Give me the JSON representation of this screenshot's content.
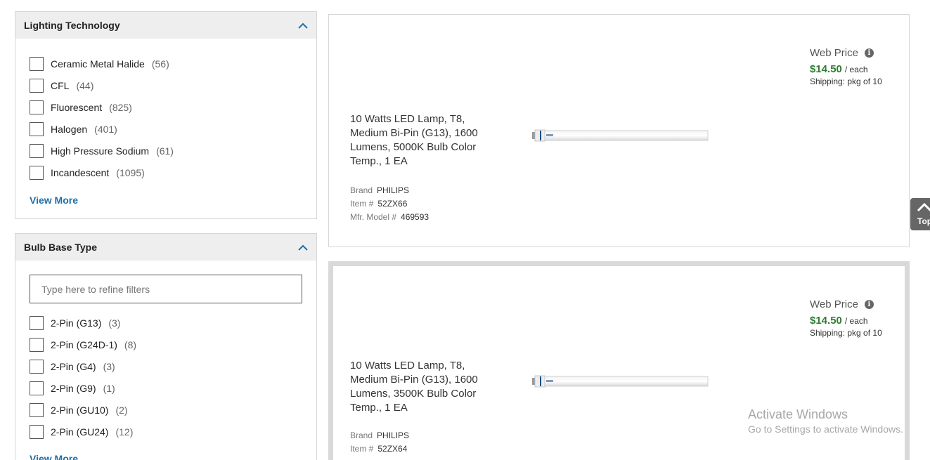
{
  "filters": [
    {
      "title": "Lighting Technology",
      "options": [
        {
          "label": "Ceramic Metal Halide",
          "count": "(56)"
        },
        {
          "label": "CFL",
          "count": "(44)"
        },
        {
          "label": "Fluorescent",
          "count": "(825)"
        },
        {
          "label": "Halogen",
          "count": "(401)"
        },
        {
          "label": "High Pressure Sodium",
          "count": "(61)"
        },
        {
          "label": "Incandescent",
          "count": "(1095)"
        }
      ],
      "view_more": "View More"
    },
    {
      "title": "Bulb Base Type",
      "search_placeholder": "Type here to refine filters",
      "options": [
        {
          "label": "2-Pin (G13)",
          "count": "(3)"
        },
        {
          "label": "2-Pin (G24D-1)",
          "count": "(8)"
        },
        {
          "label": "2-Pin (G4)",
          "count": "(3)"
        },
        {
          "label": "2-Pin (G9)",
          "count": "(1)"
        },
        {
          "label": "2-Pin (GU10)",
          "count": "(2)"
        },
        {
          "label": "2-Pin (GU24)",
          "count": "(12)"
        }
      ],
      "view_more": "View More"
    }
  ],
  "products": [
    {
      "title": "10 Watts LED Lamp, T8, Medium Bi-Pin (G13), 1600 Lumens, 5000K Bulb Color Temp., 1 EA",
      "brand_label": "Brand",
      "brand": "PHILIPS",
      "item_label": "Item #",
      "item": "52ZX66",
      "model_label": "Mfr. Model #",
      "model": "469593",
      "web_price_label": "Web Price",
      "price": "$14.50",
      "unit": "/ each",
      "shipping": "Shipping: pkg of 10"
    },
    {
      "title": "10 Watts LED Lamp, T8, Medium Bi-Pin (G13), 1600 Lumens, 3500K Bulb Color Temp., 1 EA",
      "brand_label": "Brand",
      "brand": "PHILIPS",
      "item_label": "Item #",
      "item": "52ZX64",
      "web_price_label": "Web Price",
      "price": "$14.50",
      "unit": "/ each",
      "shipping": "Shipping: pkg of 10"
    }
  ],
  "back_to_top": "Top",
  "watermark": {
    "line1": "Activate Windows",
    "line2": "Go to Settings to activate Windows."
  },
  "colors": {
    "price_green": "#2e7d32",
    "link_blue": "#1f6fa6",
    "panel_header_bg": "#eeeeee"
  },
  "icons": {
    "collapse": "chevron-up-icon",
    "info": "info-icon",
    "back_to_top": "chevron-up-icon"
  }
}
